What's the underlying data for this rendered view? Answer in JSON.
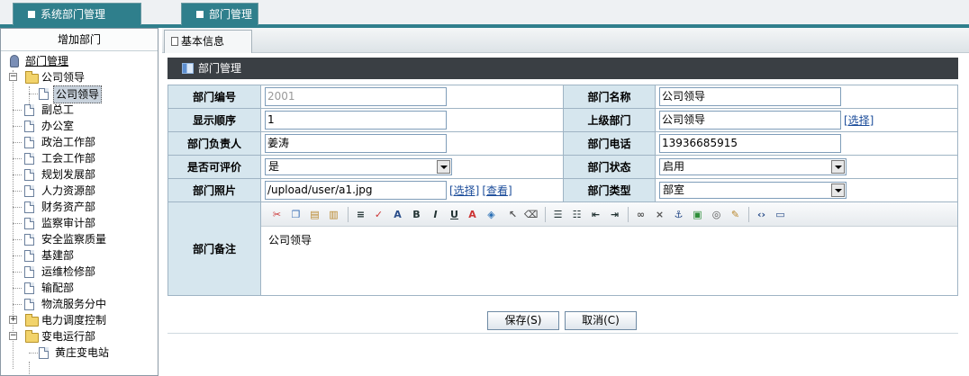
{
  "tabs": {
    "left": "系统部门管理",
    "right": "部门管理"
  },
  "left_header": "增加部门",
  "tree": {
    "root": "部门管理",
    "nodes": [
      "公司领导",
      "公司领导",
      "副总工",
      "办公室",
      "政治工作部",
      "工会工作部",
      "规划发展部",
      "人力资源部",
      "财务资产部",
      "监察审计部",
      "安全监察质量",
      "基建部",
      "运维检修部",
      "输配部",
      "物流服务分中",
      "电力调度控制",
      "变电运行部",
      "黄庄变电站"
    ]
  },
  "subtab": "基本信息",
  "section_title": "部门管理",
  "form": {
    "dept_no_label": "部门编号",
    "dept_no": "2001",
    "dept_name_label": "部门名称",
    "dept_name": "公司领导",
    "order_label": "显示顺序",
    "order": "1",
    "parent_label": "上级部门",
    "parent": "公司领导",
    "parent_link": "[选择]",
    "manager_label": "部门负责人",
    "manager": "姜涛",
    "phone_label": "部门电话",
    "phone": "13936685915",
    "eval_label": "是否可评价",
    "eval": "是",
    "status_label": "部门状态",
    "status": "启用",
    "photo_label": "部门照片",
    "photo": "/upload/user/a1.jpg",
    "photo_select": "[选择]",
    "photo_view": "[查看]",
    "type_label": "部门类型",
    "type": "部室",
    "remark_label": "部门备注",
    "remark": "公司领导"
  },
  "toolbar_icons": [
    "cut-icon",
    "copy-icon",
    "paste-icon",
    "paste-text-icon",
    "format-icon",
    "spell-icon",
    "font-size-icon",
    "bold-icon",
    "italic-icon",
    "underline-icon",
    "font-color-icon",
    "highlight-icon",
    "select-icon",
    "eraser-icon",
    "align-icon",
    "list-icon",
    "outdent-icon",
    "indent-icon",
    "link-icon",
    "unlink-icon",
    "anchor-icon",
    "image-icon",
    "flash-icon",
    "edit-icon",
    "source-icon",
    "fullscreen-icon"
  ],
  "buttons": {
    "save": "保存(S)",
    "cancel": "取消(C)"
  }
}
